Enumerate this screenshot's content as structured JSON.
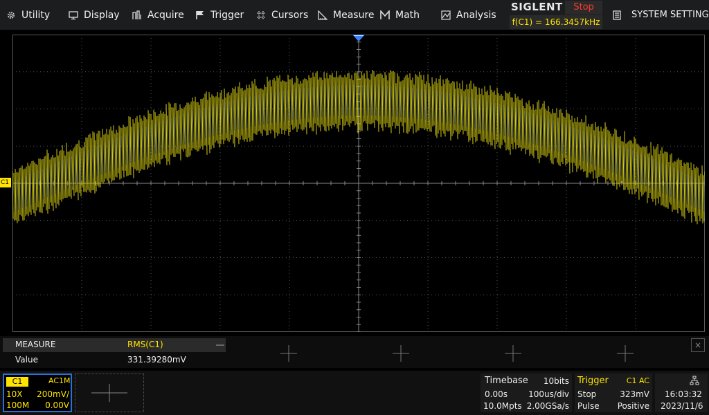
{
  "menu": {
    "items": [
      {
        "label": "Utility",
        "icon": "gear-icon"
      },
      {
        "label": "Display",
        "icon": "display-icon"
      },
      {
        "label": "Acquire",
        "icon": "acquire-icon"
      },
      {
        "label": "Trigger",
        "icon": "trigger-flag-icon"
      },
      {
        "label": "Cursors",
        "icon": "cursors-icon"
      },
      {
        "label": "Measure",
        "icon": "measure-icon"
      },
      {
        "label": "Math",
        "icon": "math-icon"
      },
      {
        "label": "Analysis",
        "icon": "analysis-icon"
      }
    ],
    "brand": "SIGLENT",
    "run_state": "Stop",
    "frequency": "f(C1) = 166.3457kHz",
    "system_setting": "SYSTEM SETTING"
  },
  "display": {
    "channel_marker": "C1",
    "trace_color": "#e6dc14",
    "grid_color": "#5a5a5a",
    "trigger_marker_color": "#3b82f6"
  },
  "measure": {
    "title": "MEASURE",
    "parameter": "RMS(C1)",
    "value_label": "Value",
    "value": "331.39280mV",
    "close_label": "×"
  },
  "channel": {
    "name": "C1",
    "coupling": "AC1M",
    "probe": "10X",
    "scale": "200mV/",
    "bandwidth": "100M",
    "offset": "0.00V",
    "color": "#ffe400"
  },
  "timebase": {
    "title": "Timebase",
    "resolution": "10bits",
    "delay": "0.00s",
    "scale": "100us/div",
    "memory": "10.0Mpts",
    "sample_rate": "2.00GSa/s"
  },
  "trigger": {
    "title": "Trigger",
    "source": "C1 AC",
    "mode": "Stop",
    "level": "323mV",
    "type": "Pulse",
    "slope": "Positive"
  },
  "clock": {
    "time": "16:03:32",
    "date": "2023/11/6",
    "network_icon": "network-icon"
  }
}
